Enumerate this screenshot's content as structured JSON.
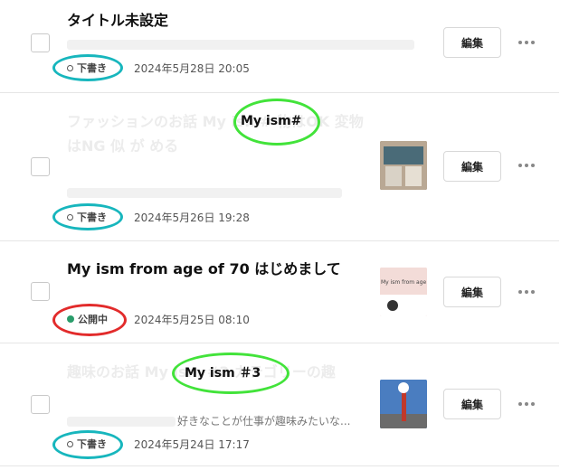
{
  "colors": {
    "draft_dot": "#555555",
    "public_dot": "#2a9d6b",
    "annotation_cyan": "#17b6bd",
    "annotation_green": "#42e33a",
    "annotation_red": "#e22b2b"
  },
  "articles": [
    {
      "title": "タイトル未設定",
      "status": "下書き",
      "date": "2024年5月28日 20:05",
      "edit_label": "編集"
    },
    {
      "title": "ファッションのお話 My ism# 物はOK 変物はNG 似 が める",
      "status": "下書き",
      "date": "2024年5月26日 19:28",
      "edit_label": "編集",
      "overlay_label": "My ism#"
    },
    {
      "title": "My ism from age of 70 はじめまして",
      "status": "公開中",
      "date": "2024年5月25日 08:10",
      "edit_label": "編集",
      "thumb_text": "My ism from age"
    },
    {
      "title": "趣味のお話 My ism #3 カテゴリーの趣",
      "excerpt": "好きなことが仕事が趣味みたいな...",
      "status": "下書き",
      "date": "2024年5月24日 17:17",
      "edit_label": "編集",
      "overlay_label": "My ism ＃3"
    }
  ]
}
